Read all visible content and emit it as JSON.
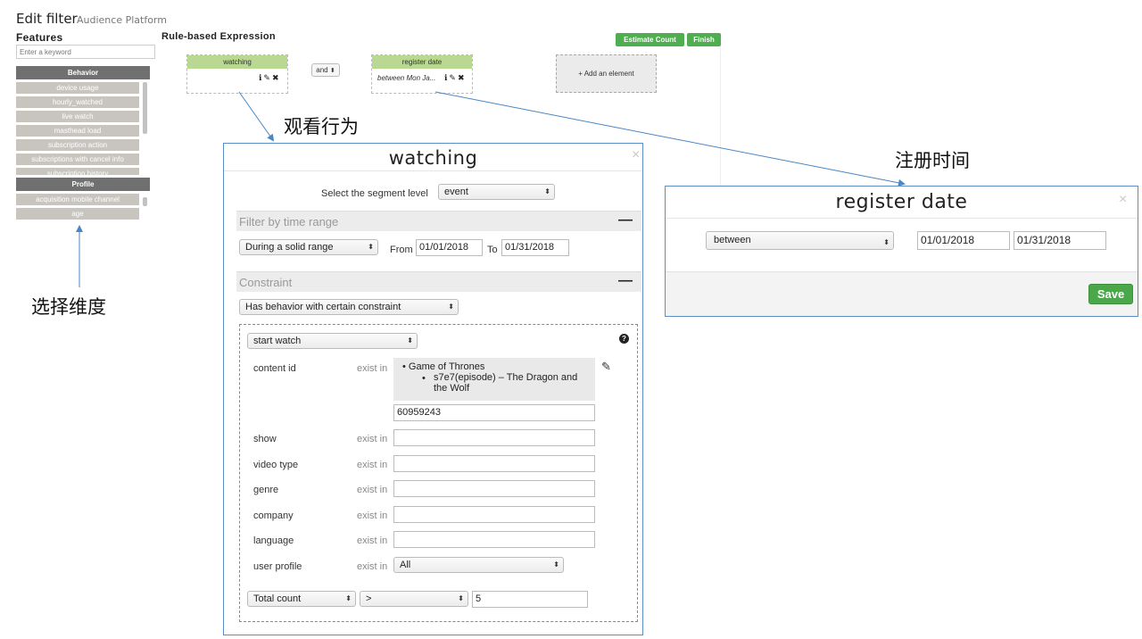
{
  "header": {
    "title": "Edit filter",
    "subtitle": "Audience Platform"
  },
  "features": {
    "title": "Features",
    "search_placeholder": "Enter a keyword",
    "behavior": {
      "label": "Behavior",
      "items": [
        "device usage",
        "hourly_watched",
        "live watch",
        "masthead load",
        "subscription action",
        "subscriptions with cancel info",
        "subscription history"
      ]
    },
    "profile": {
      "label": "Profile",
      "items": [
        "acquisition mobile channel",
        "age"
      ]
    }
  },
  "rule": {
    "title": "Rule-based Expression",
    "estimate_label": "Estimate Count",
    "finish_label": "Finish",
    "element1": {
      "name": "watching",
      "icons": "ℹ✎✖"
    },
    "operator": "and",
    "element2": {
      "name": "register date",
      "value": "between Mon Ja...",
      "icons": "ℹ✎✖"
    },
    "add_element": "+ Add an element"
  },
  "annotations": {
    "watching": "观看行为",
    "register": "注册时间",
    "dimension": "选择维度"
  },
  "watching_modal": {
    "title": "watching",
    "close": "×",
    "segment_label": "Select the segment level",
    "segment_value": "event",
    "time_section": "Filter by time range",
    "collapse": "—",
    "range_type": "During a solid range",
    "from_label": "From",
    "from_value": "01/01/2018",
    "to_label": "To",
    "to_value": "01/31/2018",
    "constraint_section": "Constraint",
    "constraint_type": "Has behavior with certain constraint",
    "action": "start watch",
    "help": "?",
    "exist_in": "exist in",
    "content_id_label": "content id",
    "content_tree": {
      "title": "Game of Thrones",
      "episode": "s7e7(episode) – The Dragon and the Wolf"
    },
    "content_id_value": "60959243",
    "fields": [
      "show",
      "video type",
      "genre",
      "company",
      "language"
    ],
    "user_profile_label": "user profile",
    "user_profile_value": "All",
    "agg": "Total count",
    "cmp": ">",
    "threshold": "5"
  },
  "register_modal": {
    "title": "register date",
    "close": "×",
    "op": "between",
    "from_value": "01/01/2018",
    "to_value": "01/31/2018",
    "save_label": "Save"
  }
}
